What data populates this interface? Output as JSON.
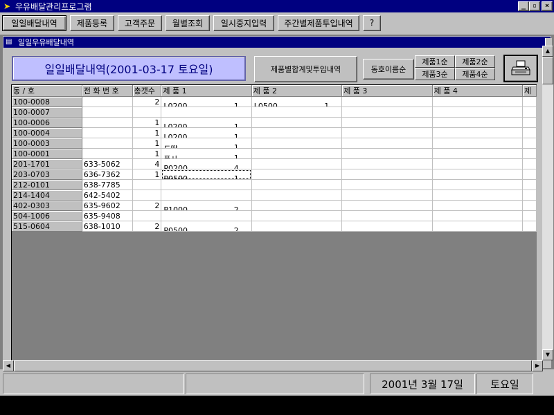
{
  "app": {
    "title": "우유배달관리프로그램"
  },
  "window_controls": {
    "minimize": "_",
    "restore": "▫",
    "close": "×"
  },
  "toolbar": {
    "buttons": [
      {
        "label": "일일배달내역"
      },
      {
        "label": "제품등록"
      },
      {
        "label": "고객주문"
      },
      {
        "label": "월별조회"
      },
      {
        "label": "일시중지입력"
      },
      {
        "label": "주간별제품투입내역"
      },
      {
        "label": "?"
      }
    ]
  },
  "child_window": {
    "title": "일일우유배달내역"
  },
  "header": {
    "date_banner": "일일배달내역(2001-03-17 토요일)",
    "product_summary_button": "제품별합계및투입내역",
    "address_sort_button": "동호이름순",
    "sort_buttons": [
      "제품1순",
      "제품2순",
      "제품3순",
      "제품4순"
    ]
  },
  "grid": {
    "columns": [
      "동     /     호",
      "전 화 번 호",
      "총갯수",
      "제 품 1",
      "제 품 2",
      "제 품 3",
      "제 품 4",
      "제"
    ],
    "rows": [
      {
        "addr": "100-0008",
        "phone": "",
        "total": "2",
        "p1_code": "L0200",
        "p1_qty": "1",
        "p2_code": "L0500",
        "p2_qty": "1"
      },
      {
        "addr": "100-0007",
        "phone": "",
        "total": "",
        "p1_code": "",
        "p1_qty": "",
        "p2_code": "",
        "p2_qty": ""
      },
      {
        "addr": "100-0006",
        "phone": "",
        "total": "1",
        "p1_code": "L0200",
        "p1_qty": "1",
        "p2_code": "",
        "p2_qty": ""
      },
      {
        "addr": "100-0004",
        "phone": "",
        "total": "1",
        "p1_code": "L0200",
        "p1_qty": "1",
        "p2_code": "",
        "p2_qty": ""
      },
      {
        "addr": "100-0003",
        "phone": "",
        "total": "1",
        "p1_code": "드딸",
        "p1_qty": "1",
        "p2_code": "",
        "p2_qty": ""
      },
      {
        "addr": "100-0001",
        "phone": "",
        "total": "1",
        "p1_code": "플사",
        "p1_qty": "1",
        "p2_code": "",
        "p2_qty": ""
      },
      {
        "addr": "201-1701",
        "phone": "633-5062",
        "total": "4",
        "p1_code": "P0200",
        "p1_qty": "4",
        "p2_code": "",
        "p2_qty": ""
      },
      {
        "addr": "203-0703",
        "phone": "636-7362",
        "total": "1",
        "p1_code": "P0500",
        "p1_qty": "1",
        "p2_code": "",
        "p2_qty": ""
      },
      {
        "addr": "212-0101",
        "phone": "638-7785",
        "total": "",
        "p1_code": "",
        "p1_qty": "",
        "p2_code": "",
        "p2_qty": ""
      },
      {
        "addr": "214-1404",
        "phone": "642-5402",
        "total": "",
        "p1_code": "",
        "p1_qty": "",
        "p2_code": "",
        "p2_qty": ""
      },
      {
        "addr": "402-0303",
        "phone": "635-9602",
        "total": "2",
        "p1_code": "P1000",
        "p1_qty": "2",
        "p2_code": "",
        "p2_qty": ""
      },
      {
        "addr": "504-1006",
        "phone": "635-9408",
        "total": "",
        "p1_code": "",
        "p1_qty": "",
        "p2_code": "",
        "p2_qty": ""
      },
      {
        "addr": "515-0604",
        "phone": "638-1010",
        "total": "2",
        "p1_code": "P0500",
        "p1_qty": "2",
        "p2_code": "",
        "p2_qty": ""
      }
    ]
  },
  "statusbar": {
    "panel1": "",
    "panel2": "",
    "date": "2001년  3월  17일",
    "weekday": "토요일"
  },
  "icons": {
    "app_icon": "milk-carton-icon",
    "child_icon": "document-icon",
    "print": "printer-icon"
  }
}
